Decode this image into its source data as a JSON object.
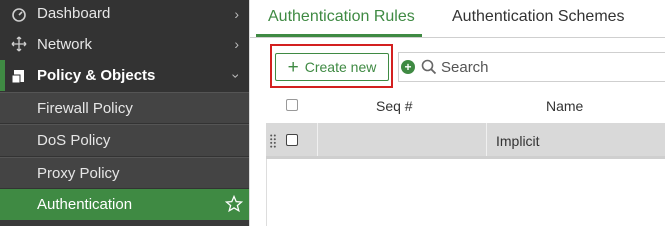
{
  "sidebar": {
    "items": [
      {
        "label": "Dashboard"
      },
      {
        "label": "Network"
      },
      {
        "label": "Policy & Objects"
      },
      {
        "label": "Firewall Policy"
      },
      {
        "label": "DoS Policy"
      },
      {
        "label": "Proxy Policy"
      },
      {
        "label": "Authentication"
      }
    ]
  },
  "tabs": [
    {
      "label": "Authentication Rules"
    },
    {
      "label": "Authentication Schemes"
    }
  ],
  "toolbar": {
    "create_label": "Create new",
    "search_placeholder": "Search"
  },
  "table": {
    "columns": [
      "Seq #",
      "Name"
    ],
    "rows": [
      {
        "name": "Implicit"
      }
    ]
  },
  "colors": {
    "accent": "#3f8a43",
    "sidebar_bg": "#333333",
    "highlight": "#d32020"
  }
}
